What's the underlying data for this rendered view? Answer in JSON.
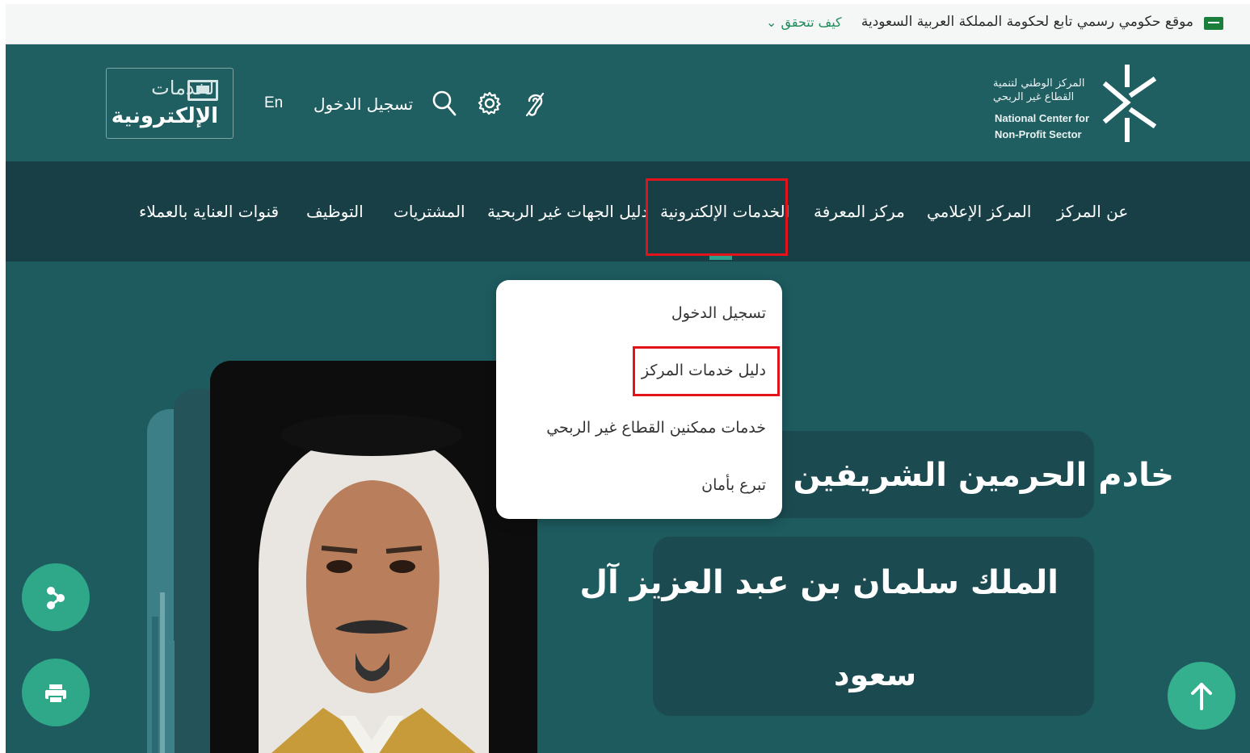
{
  "gov_bar": {
    "text": "موقع حكومي رسمي تابع لحكومة المملكة العربية السعودية",
    "verify_label": "كيف تتحقق",
    "verify_chevron": "⌄"
  },
  "header": {
    "org_name_ar_line1": "المركز الوطني لتنمية",
    "org_name_ar_line2": "القطاع غير الربحي",
    "org_name_en_line1": "National Center for",
    "org_name_en_line2": "Non-Profit Sector",
    "login_label": "تسجيل الدخول",
    "lang_label": "En",
    "badge_top": "الخدمات",
    "badge_bottom": "الإلكترونية"
  },
  "nav": {
    "items": [
      {
        "label": "عن المركز"
      },
      {
        "label": "المركز الإعلامي"
      },
      {
        "label": "مركز المعرفة"
      },
      {
        "label": "الخدمات الإلكترونية"
      },
      {
        "label": "دليل الجهات غير الربحية"
      },
      {
        "label": "المشتريات"
      },
      {
        "label": "التوظيف"
      },
      {
        "label": "قنوات العناية بالعملاء"
      }
    ]
  },
  "dropdown": {
    "items": [
      {
        "label": "تسجيل الدخول"
      },
      {
        "label": "دليل خدمات المركز"
      },
      {
        "label": "خدمات ممكنين القطاع غير الربحي"
      },
      {
        "label": "تبرع بأمان"
      }
    ]
  },
  "hero": {
    "line1": "خادم الحرمين الشريفين",
    "line2": "الملك سلمان بن عبد العزيز آل",
    "line3": "سعود"
  },
  "icons": {
    "hearing": "hearing-icon",
    "settings": "gear-icon",
    "search": "search-icon",
    "share": "share-icon",
    "print": "printer-icon",
    "scroll_top": "arrow-up-icon"
  },
  "colors": {
    "header_bg": "#1f5e61",
    "nav_bg": "#173f45",
    "accent_green": "#2fa889",
    "highlight_red": "#e3131c"
  }
}
